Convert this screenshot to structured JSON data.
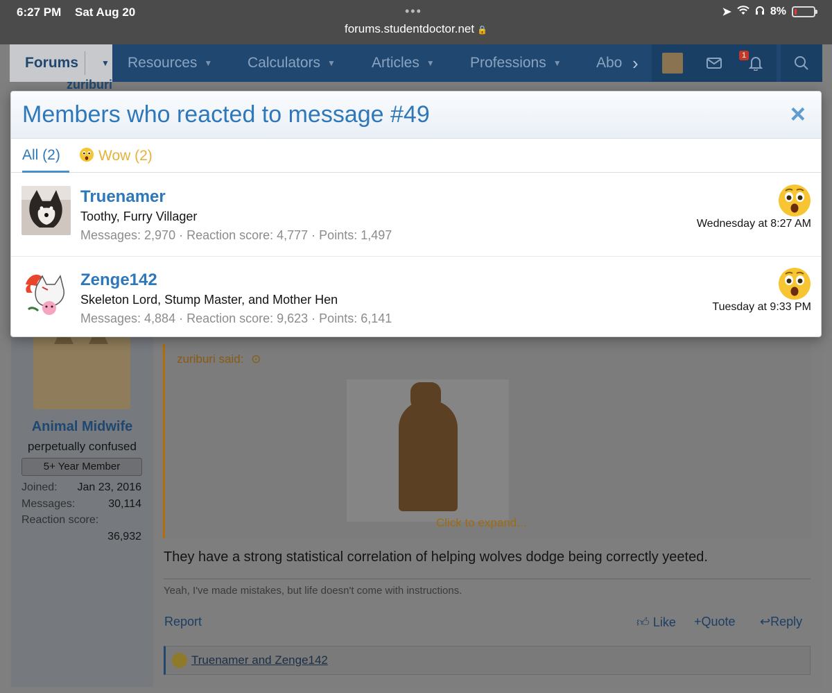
{
  "status_bar": {
    "time": "6:27 PM",
    "date": "Sat Aug 20",
    "url": "forums.studentdoctor.net",
    "battery": "8%"
  },
  "nav": {
    "items": [
      {
        "label": "Forums"
      },
      {
        "label": "Resources"
      },
      {
        "label": "Calculators"
      },
      {
        "label": "Articles"
      },
      {
        "label": "Professions"
      },
      {
        "label": "Abo"
      }
    ],
    "notification_count": "1"
  },
  "background_thread": {
    "top_username": "zuriburi",
    "poster": {
      "name": "Animal Midwife",
      "title": "perpetually confused",
      "badge": "5+ Year Member",
      "joined_label": "Joined:",
      "joined_value": "Jan 23, 2016",
      "messages_label": "Messages:",
      "messages_value": "30,114",
      "reaction_label": "Reaction score:",
      "reaction_value": "36,932"
    },
    "quote_said": "zuriburi said:",
    "click_to_expand": "Click to expand...",
    "post_text": "They have a strong statistical correlation of helping wolves dodge being correctly yeeted.",
    "signature": "Yeah, I've made mistakes, but life doesn't come with instructions.",
    "actions": {
      "report": "Report",
      "like": "Like",
      "quote": "Quote",
      "reply": "Reply"
    },
    "reactions_summary": "Truenamer and Zenge142"
  },
  "modal": {
    "title": "Members who reacted to message #49",
    "close": "×",
    "tabs": [
      {
        "label": "All (2)"
      },
      {
        "label": "Wow (2)"
      }
    ],
    "reactions": [
      {
        "name": "Truenamer",
        "title": "Toothy, Furry Villager",
        "stats": "Messages: 2,970 · Reaction score: 4,777 · Points: 1,497",
        "time": "Wednesday at 8:27 AM",
        "reaction_icon": "wow-emoji"
      },
      {
        "name": "Zenge142",
        "title": "Skeleton Lord, Stump Master, and Mother Hen",
        "stats": "Messages: 4,884 · Reaction score: 9,623 · Points: 6,141",
        "time": "Tuesday at 9:33 PM",
        "reaction_icon": "wow-emoji"
      }
    ]
  },
  "colors": {
    "link_blue": "#2e77b8",
    "nav_bg": "#1f4770",
    "wow_yellow": "#e6b23a",
    "quote_orange": "#b06d0a"
  }
}
